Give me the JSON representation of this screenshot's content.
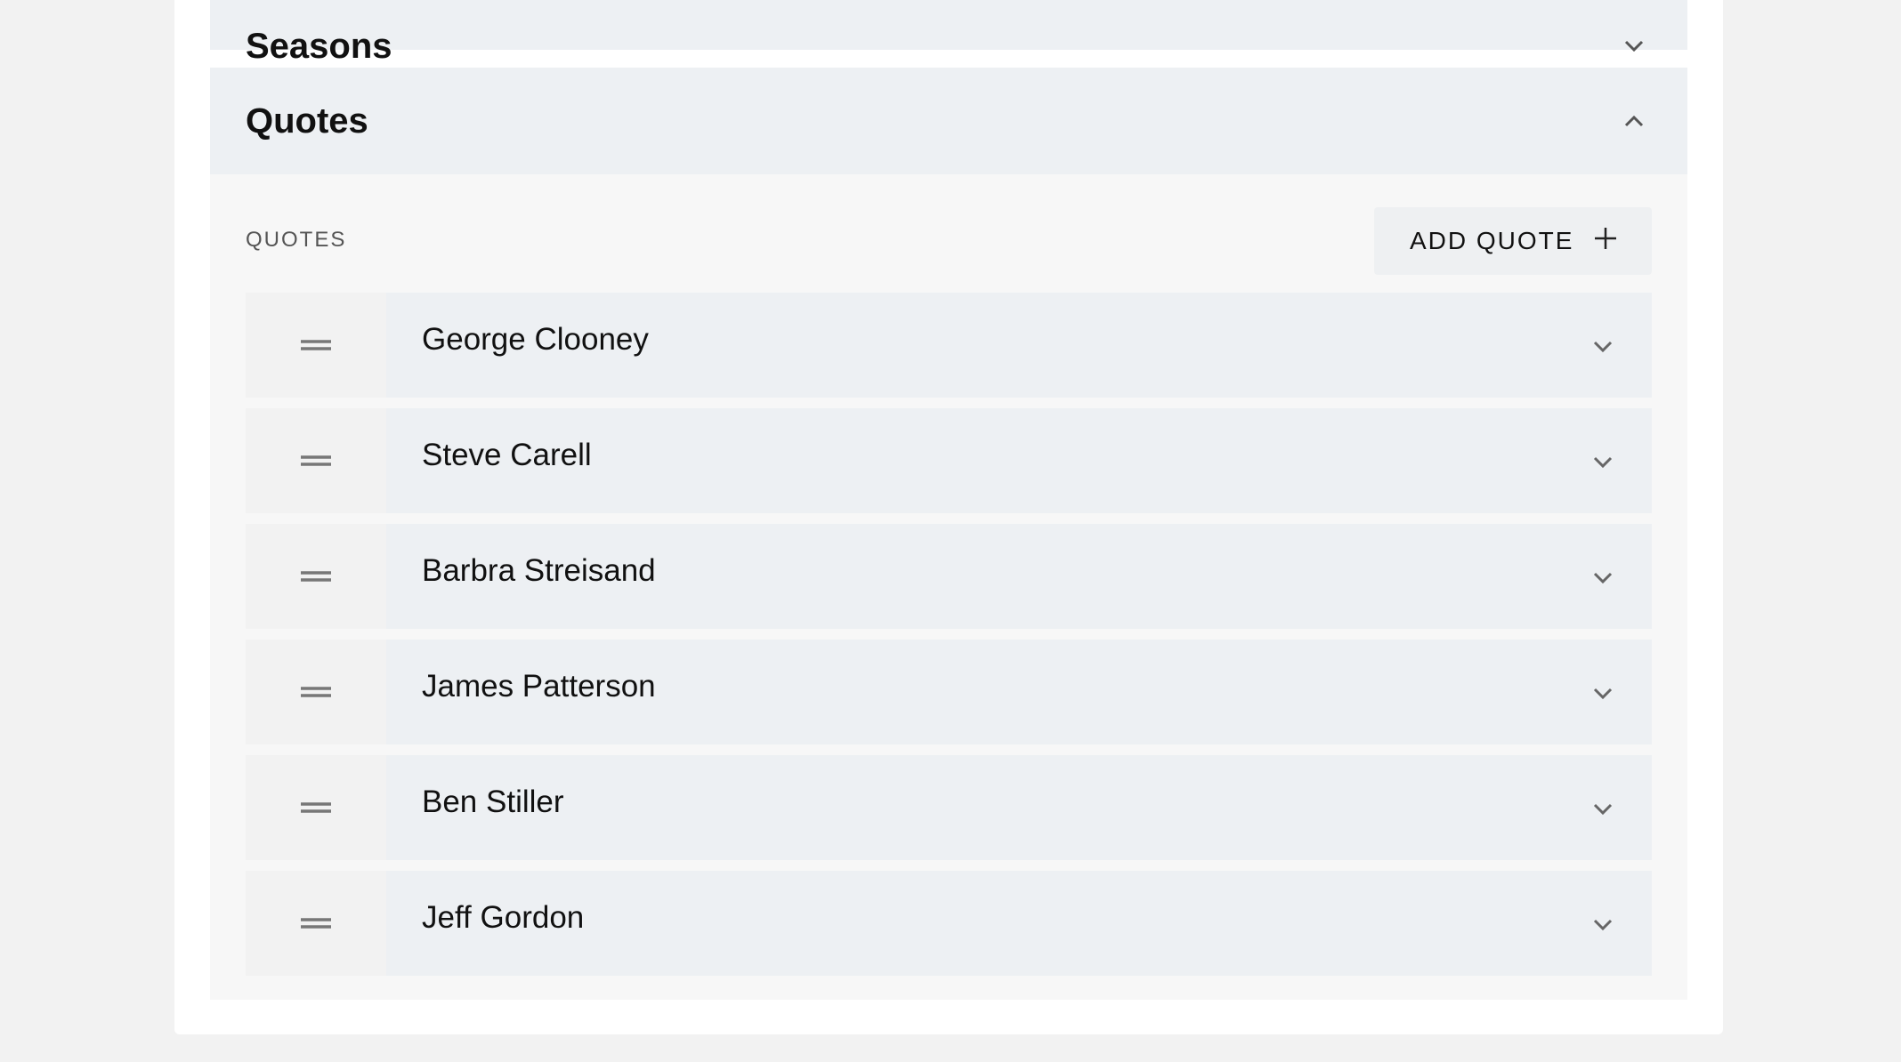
{
  "sections": {
    "seasons": {
      "title": "Seasons",
      "expanded": false
    },
    "quotes": {
      "title": "Quotes",
      "expanded": true,
      "field_label": "QUOTES",
      "add_button_label": "ADD QUOTE",
      "items": [
        {
          "label": "George Clooney"
        },
        {
          "label": "Steve Carell"
        },
        {
          "label": "Barbra Streisand"
        },
        {
          "label": "James Patterson"
        },
        {
          "label": "Ben Stiller"
        },
        {
          "label": "Jeff Gordon"
        }
      ]
    }
  },
  "icons": {
    "section_collapse": "chevron-up-icon",
    "section_expand": "chevron-down-icon",
    "add": "plus-icon",
    "drag": "drag-handle-icon",
    "row_expand": "chevron-down-icon"
  },
  "colors": {
    "page_background": "#f2f2f2",
    "card_background": "#ffffff",
    "header_background": "#edf0f3",
    "body_background": "#f7f7f7",
    "icon_color": "#666666"
  }
}
